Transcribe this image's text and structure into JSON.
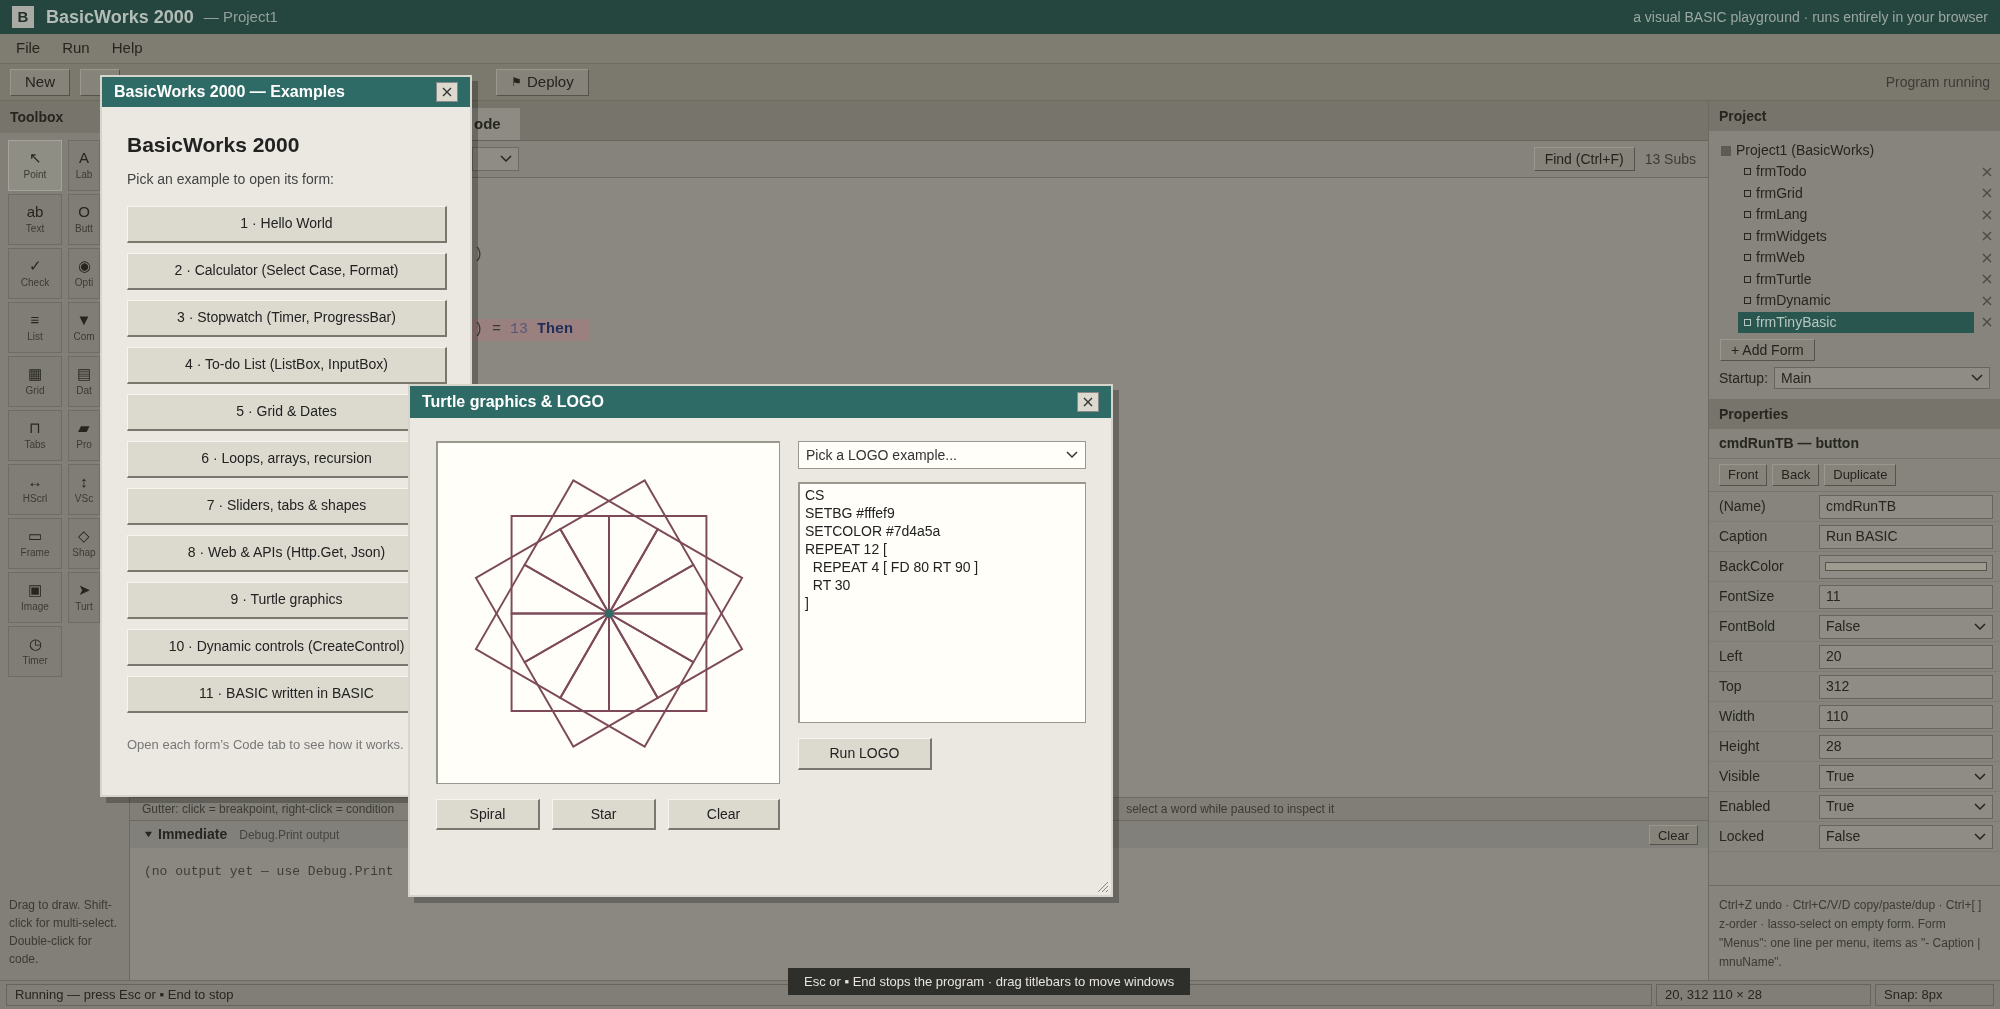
{
  "title_bar": {
    "logo": "B",
    "app_name": "BasicWorks 2000",
    "project": "— Project1",
    "tagline": "a visual BASIC playground · runs entirely in your browser"
  },
  "menu": [
    "File",
    "Run",
    "Help"
  ],
  "toolbar": {
    "buttons": [
      "New"
    ],
    "deploy": {
      "icon": "⚑",
      "label": "Deploy"
    },
    "status": "Program running"
  },
  "toolbox": {
    "title": "Toolbox",
    "tools": [
      {
        "icon": "↖",
        "label": "Point",
        "selected": true
      },
      {
        "icon": "A",
        "label": "Lab",
        "selected": false
      },
      {
        "icon": "ab",
        "label": "Text",
        "selected": false
      },
      {
        "icon": "O",
        "label": "Butt",
        "selected": false
      },
      {
        "icon": "✓",
        "label": "Check",
        "selected": false
      },
      {
        "icon": "◉",
        "label": "Opti",
        "selected": false
      },
      {
        "icon": "≡",
        "label": "List",
        "selected": false
      },
      {
        "icon": "▼",
        "label": "Com",
        "selected": false
      },
      {
        "icon": "▦",
        "label": "Grid",
        "selected": false
      },
      {
        "icon": "▤",
        "label": "Dat",
        "selected": false
      },
      {
        "icon": "⊓",
        "label": "Tabs",
        "selected": false
      },
      {
        "icon": "▰",
        "label": "Pro",
        "selected": false
      },
      {
        "icon": "↔",
        "label": "HScrl",
        "selected": false
      },
      {
        "icon": "↕",
        "label": "VSc",
        "selected": false
      },
      {
        "icon": "▭",
        "label": "Frame",
        "selected": false
      },
      {
        "icon": "◇",
        "label": "Shap",
        "selected": false
      },
      {
        "icon": "▣",
        "label": "Image",
        "selected": false
      },
      {
        "icon": "➤",
        "label": "Turt",
        "selected": false
      },
      {
        "icon": "◷",
        "label": "Timer",
        "selected": false
      }
    ],
    "hint": "Drag to draw. Shift-click for multi-select. Double-click for code."
  },
  "editor": {
    "tab": {
      "label": "ode",
      "selected": true
    },
    "find_button": "Find (Ctrl+F)",
    "sub_count": "13 Subs",
    "lines": [
      {
        "highlighted": false,
        "tokens": [
          {
            "kind": "plain",
            "text": ")"
          }
        ]
      },
      {
        "highlighted": true,
        "tokens": [
          {
            "kind": "plain",
            "text": ") = "
          },
          {
            "kind": "number",
            "text": "13"
          },
          {
            "kind": "keyword",
            "text": " Then"
          }
        ]
      }
    ]
  },
  "gutter_hint": [
    "Gutter: click = breakpoint, right-click = condition",
    "select a word while paused to inspect it"
  ],
  "immediate": {
    "expanded": true,
    "title": "Immediate",
    "subtitle": "Debug.Print output",
    "clear": "Clear",
    "output": "(no output yet — use Debug.Print"
  },
  "project": {
    "title": "Project",
    "root": "Project1 (BasicWorks)",
    "forms": [
      {
        "name": "frmTodo",
        "selected": false
      },
      {
        "name": "frmGrid",
        "selected": false
      },
      {
        "name": "frmLang",
        "selected": false
      },
      {
        "name": "frmWidgets",
        "selected": false
      },
      {
        "name": "frmWeb",
        "selected": false
      },
      {
        "name": "frmTurtle",
        "selected": false
      },
      {
        "name": "frmDynamic",
        "selected": false
      },
      {
        "name": "frmTinyBasic",
        "selected": true
      }
    ],
    "add_button": "+ Add Form",
    "startup_label": "Startup:",
    "startup_value": "Main"
  },
  "properties": {
    "title": "Properties",
    "object": "cmdRunTB — button",
    "buttons": [
      "Front",
      "Back",
      "Duplicate"
    ],
    "rows": [
      {
        "name": "(Name)",
        "kind": "text",
        "value": "cmdRunTB"
      },
      {
        "name": "Caption",
        "kind": "text",
        "value": "Run BASIC"
      },
      {
        "name": "BackColor",
        "kind": "color",
        "color": "#9e9b91"
      },
      {
        "name": "FontSize",
        "kind": "text",
        "value": "11"
      },
      {
        "name": "FontBold",
        "kind": "select",
        "value": "False"
      },
      {
        "name": "Left",
        "kind": "text",
        "value": "20"
      },
      {
        "name": "Top",
        "kind": "text",
        "value": "312"
      },
      {
        "name": "Width",
        "kind": "text",
        "value": "110"
      },
      {
        "name": "Height",
        "kind": "text",
        "value": "28"
      },
      {
        "name": "Visible",
        "kind": "select",
        "value": "True"
      },
      {
        "name": "Enabled",
        "kind": "select",
        "value": "True"
      },
      {
        "name": "Locked",
        "kind": "select",
        "value": "False"
      }
    ],
    "hint": "Ctrl+Z undo · Ctrl+C/V/D copy/paste/dup · Ctrl+[ ] z-order · lasso-select on empty form. Form \"Menus\": one line per menu, items as \"- Caption | mnuName\"."
  },
  "status_bar": {
    "message": "Running — press Esc or ▪ End to stop",
    "position": "20, 312 110 × 28",
    "snap": "Snap: 8px"
  },
  "toast": "Esc or ▪ End stops the program · drag titlebars to move windows",
  "examples_dialog": {
    "title": "BasicWorks 2000 — Examples",
    "heading": "BasicWorks 2000",
    "subtitle": "Pick an example to open its form:",
    "examples": [
      "1 · Hello World",
      "2 · Calculator (Select Case, Format)",
      "3 · Stopwatch (Timer, ProgressBar)",
      "4 · To-do List (ListBox, InputBox)",
      "5 · Grid & Dates",
      "6 · Loops, arrays, recursion",
      "7 · Sliders, tabs & shapes",
      "8 · Web & APIs (Http.Get, Json)",
      "9 · Turtle graphics",
      "10 · Dynamic controls (CreateControl)",
      "11 · BASIC written in BASIC"
    ],
    "footer": "Open each form’s Code tab to see how it works."
  },
  "turtle_dialog": {
    "title": "Turtle graphics & LOGO",
    "example_select": "Pick a LOGO example...",
    "code": [
      "CS",
      "SETBG #fffef9",
      "SETCOLOR #7d4a5a",
      "REPEAT 12 [",
      "  REPEAT 4 [ FD 80 RT 90 ]",
      "  RT 30",
      "]"
    ],
    "run_button": "Run LOGO",
    "buttons": [
      "Spiral",
      "Star",
      "Clear"
    ]
  }
}
